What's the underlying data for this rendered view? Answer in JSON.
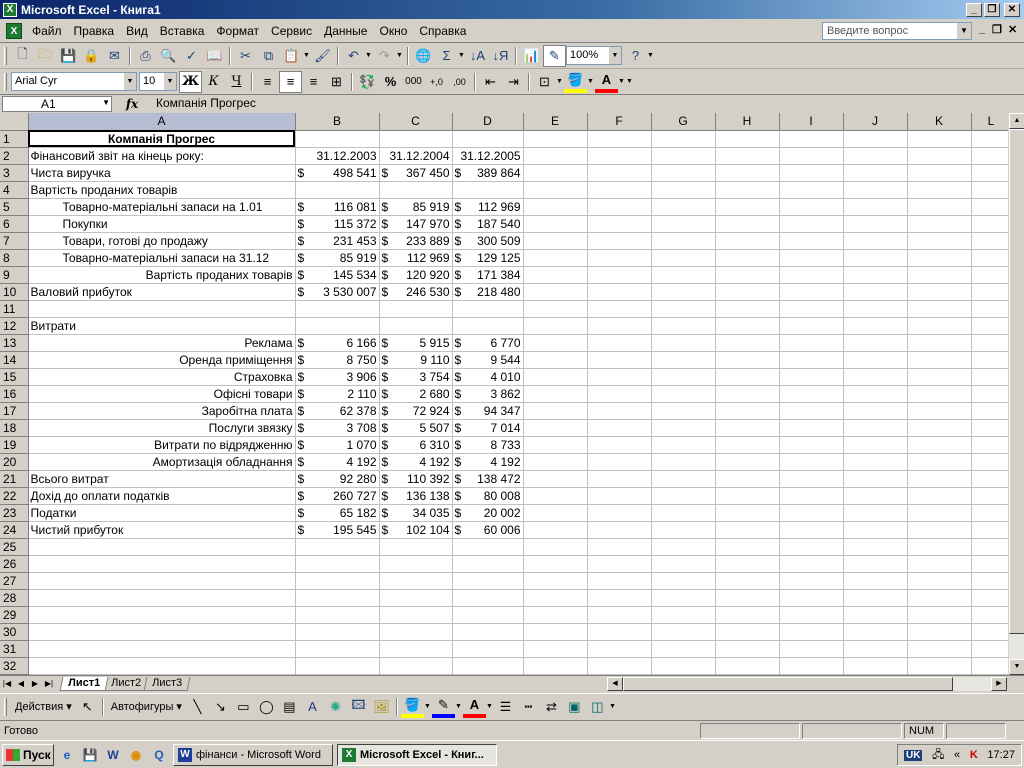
{
  "window": {
    "title": "Microsoft Excel - Книга1",
    "minimize": "_",
    "restore": "❐",
    "close": "✕"
  },
  "menu": {
    "items": [
      "Файл",
      "Правка",
      "Вид",
      "Вставка",
      "Формат",
      "Сервис",
      "Данные",
      "Окно",
      "Справка"
    ],
    "help_placeholder": "Введите вопрос"
  },
  "toolbar": {
    "zoom": "100%",
    "font_name": "Arial Cyr",
    "font_size": "10",
    "bold": "Ж",
    "italic": "К",
    "underline": "Ч",
    "percent": "%",
    "thousands": "000",
    "inc_decimal": "+,0",
    "dec_decimal": ",00",
    "sum": "Σ"
  },
  "formula_bar": {
    "cell_ref": "A1",
    "fx": "fx",
    "content": "Компанія Прогрес"
  },
  "columns": [
    "A",
    "B",
    "C",
    "D",
    "E",
    "F",
    "G",
    "H",
    "I",
    "J",
    "K",
    "L"
  ],
  "rows": [
    {
      "n": "1",
      "a": "Компанія Прогрес",
      "style": "title"
    },
    {
      "n": "2",
      "a": "Фінансовий звіт на кінець року:",
      "b": "31.12.2003",
      "c": "31.12.2004",
      "d": "31.12.2005",
      "style": "dates"
    },
    {
      "n": "3",
      "a": "Чиста виручка",
      "b": "498 541",
      "c": "367 450",
      "d": "389 864"
    },
    {
      "n": "4",
      "a": "Вартість проданих товарів"
    },
    {
      "n": "5",
      "a": "Товарно-матеріальні запаси на 1.01",
      "b": "116 081",
      "c": "85 919",
      "d": "112 969",
      "style": "indent"
    },
    {
      "n": "6",
      "a": "Покупки",
      "b": "115 372",
      "c": "147 970",
      "d": "187 540",
      "style": "indent"
    },
    {
      "n": "7",
      "a": "Товари, готові до продажу",
      "b": "231 453",
      "c": "233 889",
      "d": "300 509",
      "style": "indent"
    },
    {
      "n": "8",
      "a": "Товарно-матеріальні запаси на 31.12",
      "b": "85 919",
      "c": "112 969",
      "d": "129 125",
      "style": "indent"
    },
    {
      "n": "9",
      "a": "Вартість проданих товарів",
      "b": "145 534",
      "c": "120 920",
      "d": "171 384",
      "style": "right"
    },
    {
      "n": "10",
      "a": "Валовий прибуток",
      "b": "3 530 007",
      "c": "246 530",
      "d": "218 480"
    },
    {
      "n": "11"
    },
    {
      "n": "12",
      "a": "Витрати"
    },
    {
      "n": "13",
      "a": "Реклама",
      "b": "6 166",
      "c": "5 915",
      "d": "6 770",
      "style": "right"
    },
    {
      "n": "14",
      "a": "Оренда приміщення",
      "b": "8 750",
      "c": "9 110",
      "d": "9 544",
      "style": "right"
    },
    {
      "n": "15",
      "a": "Страховка",
      "b": "3 906",
      "c": "3 754",
      "d": "4 010",
      "style": "right"
    },
    {
      "n": "16",
      "a": "Офісні товари",
      "b": "2 110",
      "c": "2 680",
      "d": "3 862",
      "style": "right"
    },
    {
      "n": "17",
      "a": "Заробітна плата",
      "b": "62 378",
      "c": "72 924",
      "d": "94 347",
      "style": "right"
    },
    {
      "n": "18",
      "a": "Послуги звязку",
      "b": "3 708",
      "c": "5 507",
      "d": "7 014",
      "style": "right"
    },
    {
      "n": "19",
      "a": "Витрати по відрядженню",
      "b": "1 070",
      "c": "6 310",
      "d": "8 733",
      "style": "right"
    },
    {
      "n": "20",
      "a": "Амортизація обладнання",
      "b": "4 192",
      "c": "4 192",
      "d": "4 192",
      "style": "right"
    },
    {
      "n": "21",
      "a": "Всього витрат",
      "b": "92 280",
      "c": "110 392",
      "d": "138 472"
    },
    {
      "n": "22",
      "a": "Дохід до оплати податків",
      "b": "260 727",
      "c": "136 138",
      "d": "80 008"
    },
    {
      "n": "23",
      "a": "Податки",
      "b": "65 182",
      "c": "34 035",
      "d": "20 002"
    },
    {
      "n": "24",
      "a": "Чистий прибуток",
      "b": "195 545",
      "c": "102 104",
      "d": "60 006"
    },
    {
      "n": "25"
    },
    {
      "n": "26"
    },
    {
      "n": "27"
    },
    {
      "n": "28"
    },
    {
      "n": "29"
    },
    {
      "n": "30"
    },
    {
      "n": "31"
    },
    {
      "n": "32"
    }
  ],
  "currency_symbol": "$",
  "sheets": [
    "Лист1",
    "Лист2",
    "Лист3"
  ],
  "drawing": {
    "actions": "Действия",
    "autoshapes": "Автофигуры"
  },
  "status": {
    "text": "Готово",
    "num": "NUM"
  },
  "taskbar": {
    "start": "Пуск",
    "tasks": [
      {
        "label": "фінанси - Microsoft Word",
        "icon": "W"
      },
      {
        "label": "Microsoft Excel - Книг...",
        "icon": "X"
      }
    ],
    "lang": "UK",
    "clock": "17:27"
  }
}
